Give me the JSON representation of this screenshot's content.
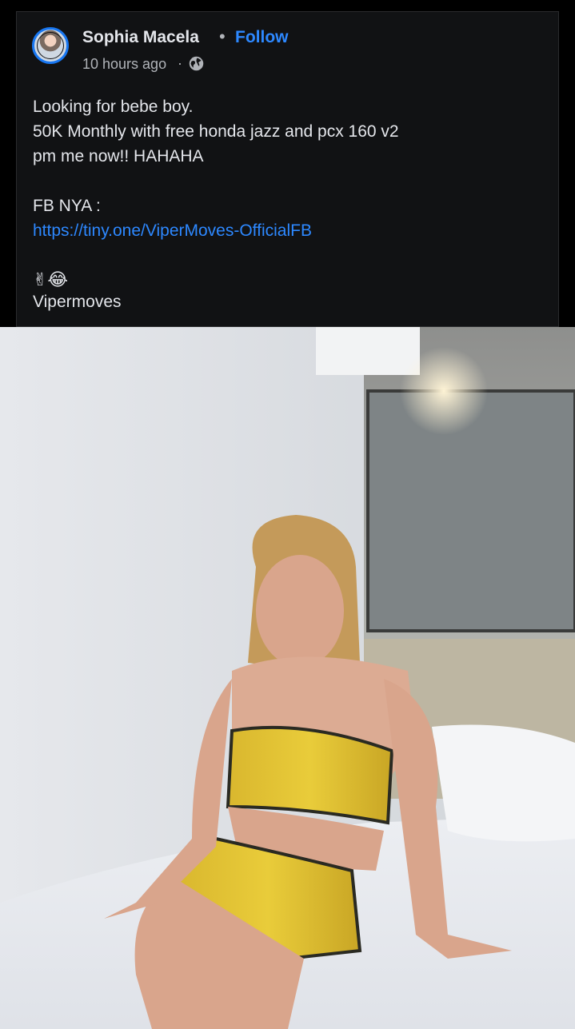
{
  "post": {
    "author": "Sophia Macela",
    "separator": "•",
    "follow_label": "Follow",
    "timestamp": "10 hours ago",
    "timestamp_separator": "·",
    "audience_icon": "globe-icon",
    "body_lines": [
      "Looking for bebe boy.",
      "50K Monthly with free honda jazz and pcx 160 v2",
      "pm me now!! HAHAHA"
    ],
    "fb_label": "FB NYA :",
    "link": "https://tiny.one/ViperMoves-OfficialFB",
    "emojis": "✌😂",
    "signature": "Vipermoves"
  },
  "photo": {
    "subject": "woman in yellow two-piece outfit sitting on bed"
  },
  "colors": {
    "background": "#000000",
    "card": "#111214",
    "text": "#e4e6eb",
    "muted": "#b0b3b8",
    "accent": "#2d88ff"
  }
}
